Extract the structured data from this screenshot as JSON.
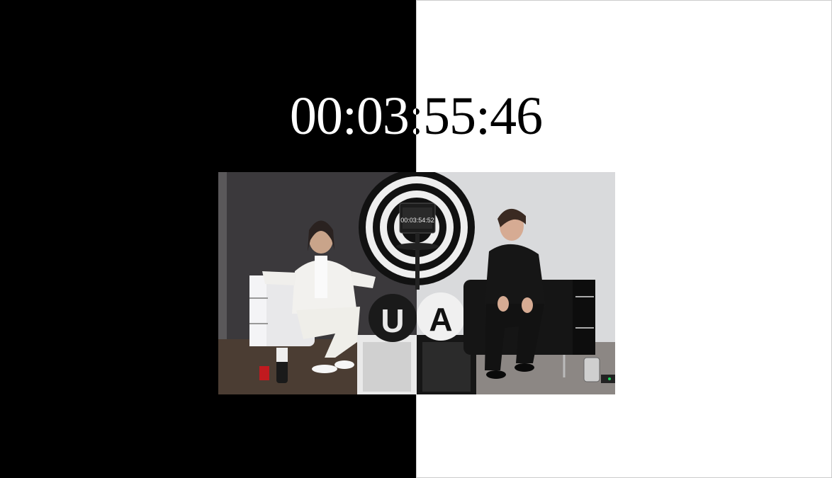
{
  "timer": {
    "display": "00:03:55:46"
  },
  "video": {
    "screen_timer": "00:03:54:52",
    "left_rose_letter": "U",
    "right_rose_letter": "A"
  },
  "colors": {
    "left_half": "#000000",
    "right_half": "#ffffff"
  }
}
